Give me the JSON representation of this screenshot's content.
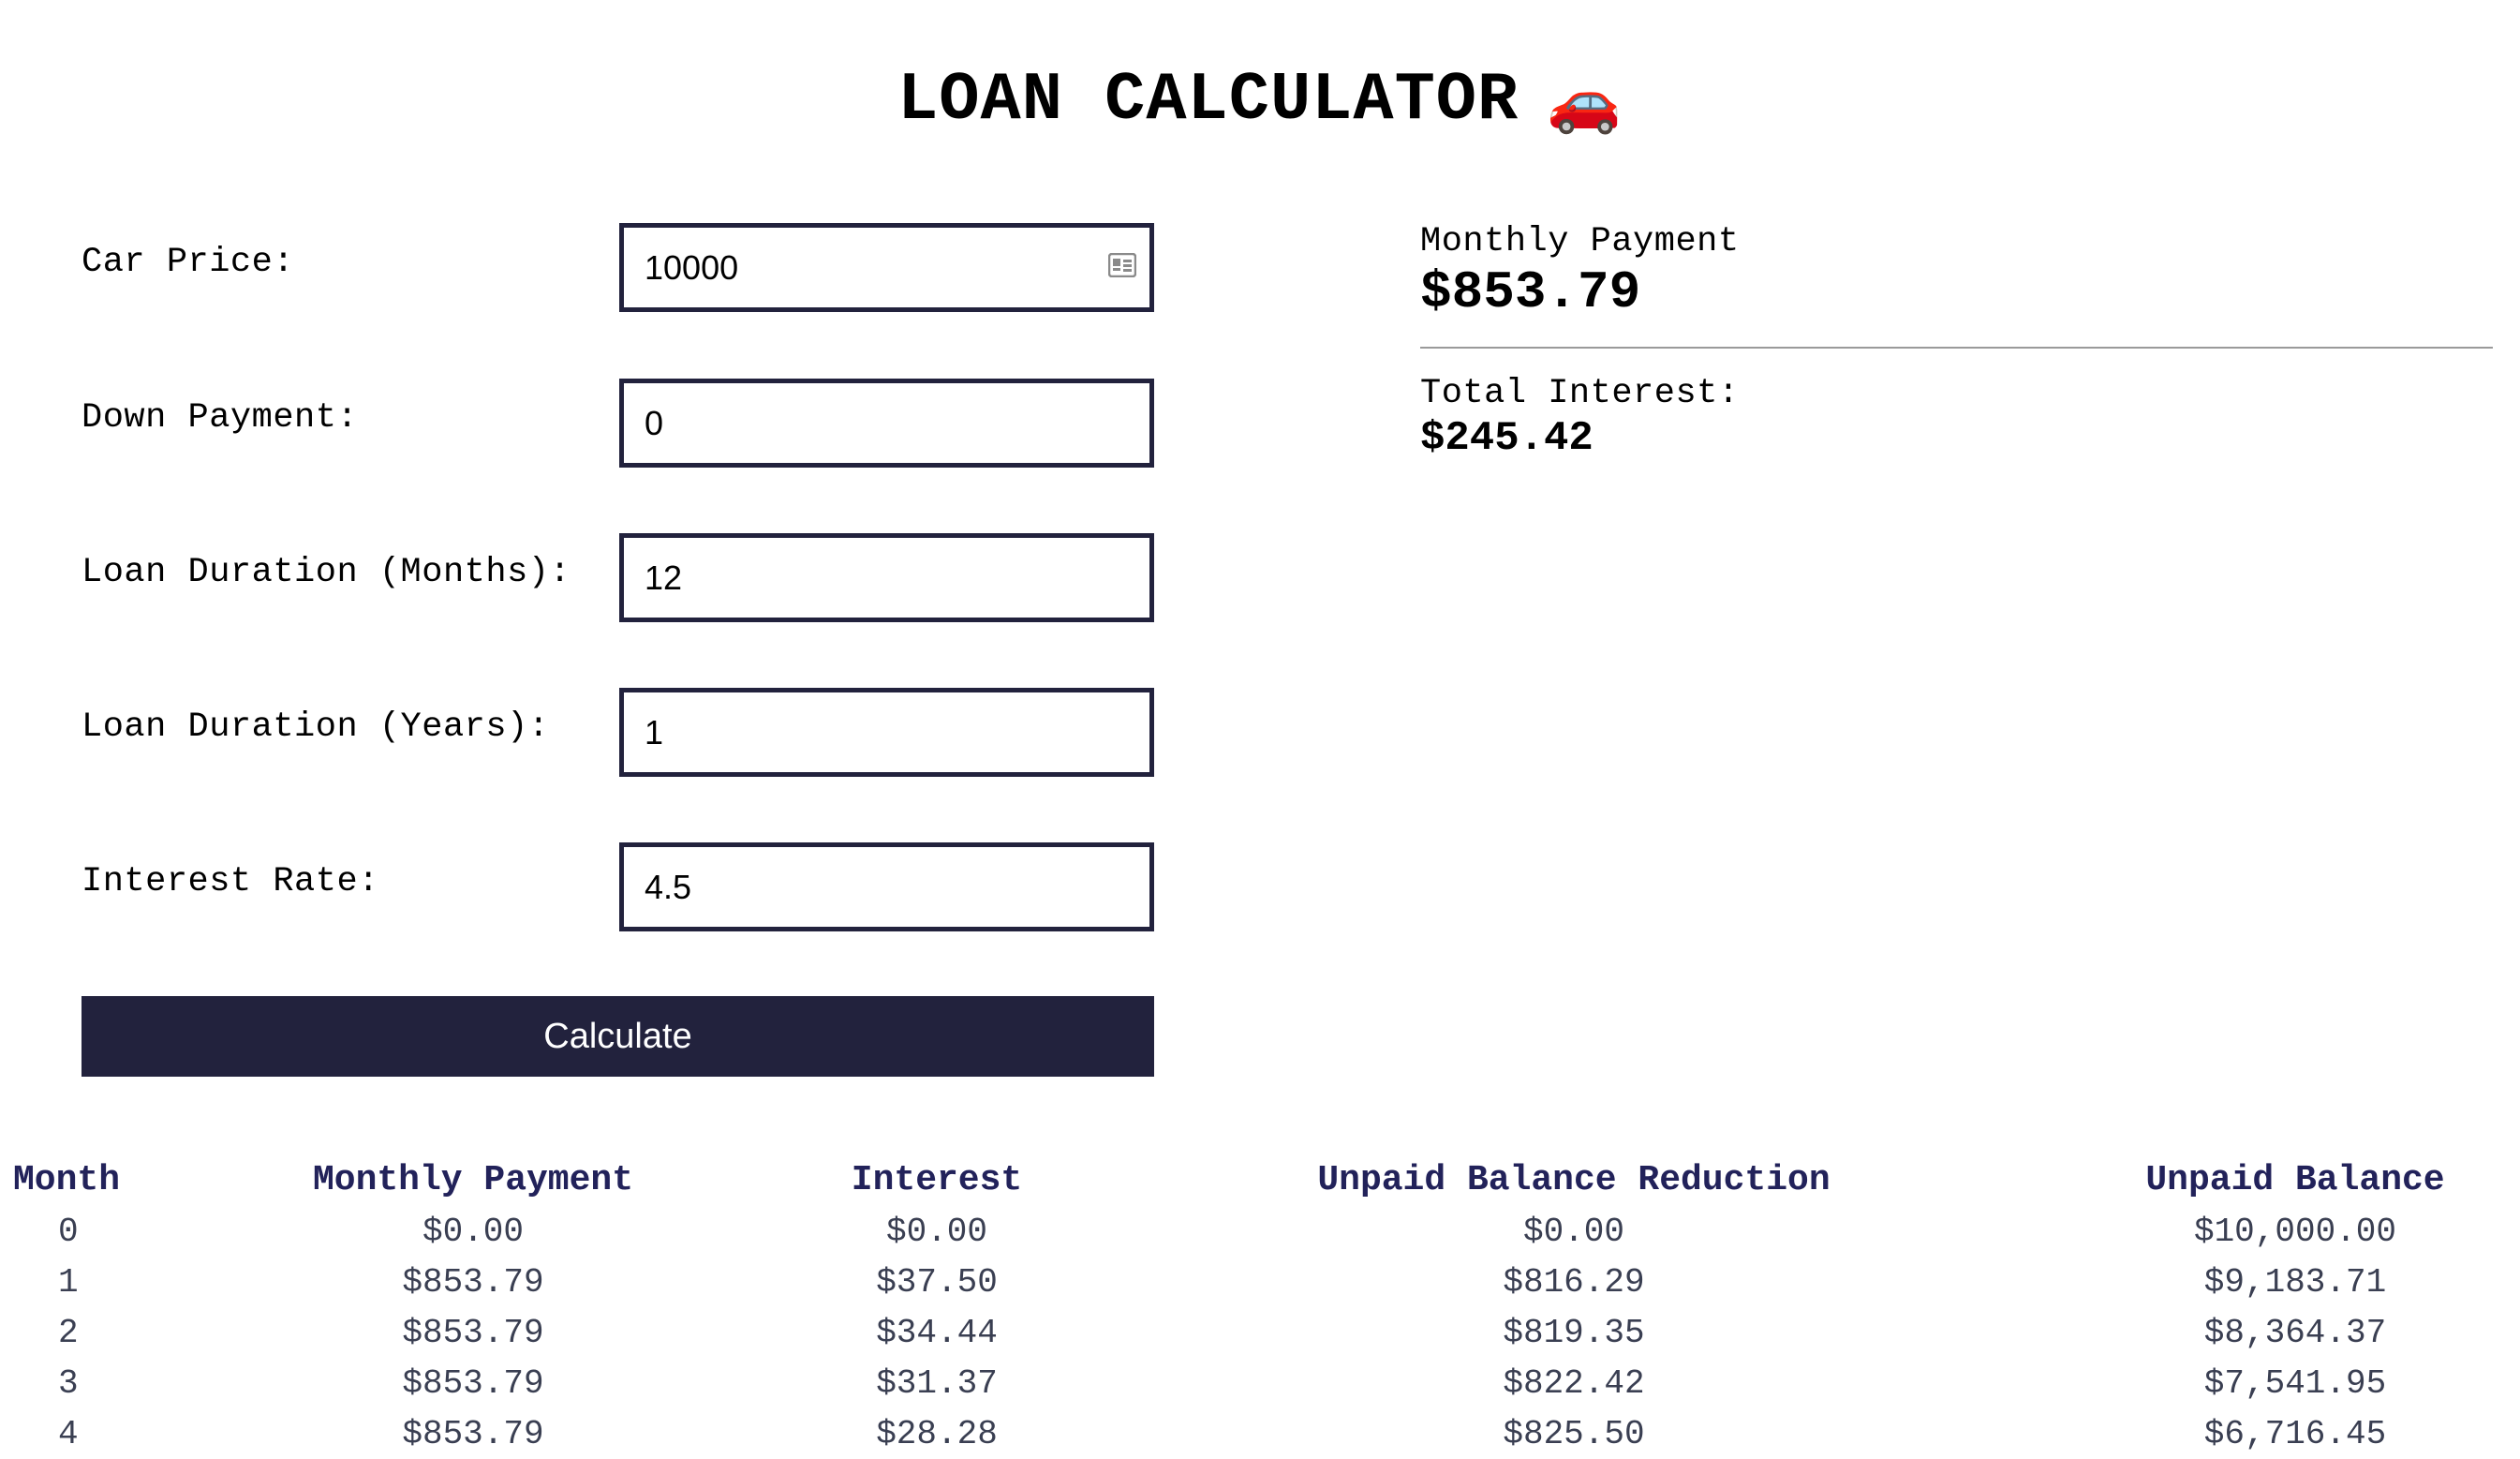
{
  "header": {
    "title": "LOAN CALCULATOR",
    "icon": "car-icon"
  },
  "form": {
    "car_price": {
      "label": "Car Price:",
      "value": "10000"
    },
    "down_payment": {
      "label": "Down Payment:",
      "value": "0"
    },
    "duration_months": {
      "label": "Loan Duration (Months):",
      "value": "12"
    },
    "duration_years": {
      "label": "Loan Duration (Years):",
      "value": "1"
    },
    "interest_rate": {
      "label": "Interest Rate:",
      "value": "4.5"
    },
    "calculate_label": "Calculate"
  },
  "results": {
    "monthly_payment_label": "Monthly Payment",
    "monthly_payment_value": "$853.79",
    "total_interest_label": "Total Interest:",
    "total_interest_value": "$245.42"
  },
  "schedule": {
    "headers": [
      "Month",
      "Monthly Payment",
      "Interest",
      "Unpaid Balance Reduction",
      "Unpaid Balance"
    ],
    "rows": [
      [
        "0",
        "$0.00",
        "$0.00",
        "$0.00",
        "$10,000.00"
      ],
      [
        "1",
        "$853.79",
        "$37.50",
        "$816.29",
        "$9,183.71"
      ],
      [
        "2",
        "$853.79",
        "$34.44",
        "$819.35",
        "$8,364.37"
      ],
      [
        "3",
        "$853.79",
        "$31.37",
        "$822.42",
        "$7,541.95"
      ],
      [
        "4",
        "$853.79",
        "$28.28",
        "$825.50",
        "$6,716.45"
      ]
    ]
  },
  "colors": {
    "accent": "#22223d",
    "table_header": "#22225a",
    "table_text": "#3a3f52"
  }
}
